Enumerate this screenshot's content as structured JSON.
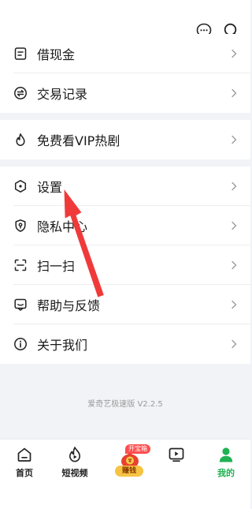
{
  "header": {
    "message_icon": "chat-bubble-icon",
    "search_icon": "search-icon"
  },
  "groups": [
    {
      "items": [
        {
          "label": "借现金",
          "icon": "wallet-icon"
        },
        {
          "label": "交易记录",
          "icon": "exchange-icon"
        }
      ]
    },
    {
      "items": [
        {
          "label": "免费看VIP热剧",
          "icon": "flame-icon"
        }
      ]
    },
    {
      "items": [
        {
          "label": "设置",
          "icon": "hexagon-settings-icon"
        },
        {
          "label": "隐私中心",
          "icon": "shield-location-icon"
        },
        {
          "label": "扫一扫",
          "icon": "scan-icon"
        },
        {
          "label": "帮助与反馈",
          "icon": "feedback-icon"
        },
        {
          "label": "关于我们",
          "icon": "info-icon"
        }
      ]
    }
  ],
  "footer": {
    "version": "爱奇艺极速版 V2.2.5"
  },
  "tabbar": {
    "tabs": [
      {
        "label": "首页",
        "icon": "home-icon"
      },
      {
        "label": "短视频",
        "icon": "short-video-icon"
      },
      {
        "label": "赚钱",
        "icon": "money-bag-icon",
        "badge": "开宝箱"
      },
      {
        "label": "",
        "icon": "tv-play-icon"
      },
      {
        "label": "我的",
        "icon": "profile-icon",
        "active": true
      }
    ],
    "active_color": "#1fb153"
  },
  "annotation": {
    "arrow_color": "#f03a3a",
    "points_to": "设置"
  }
}
